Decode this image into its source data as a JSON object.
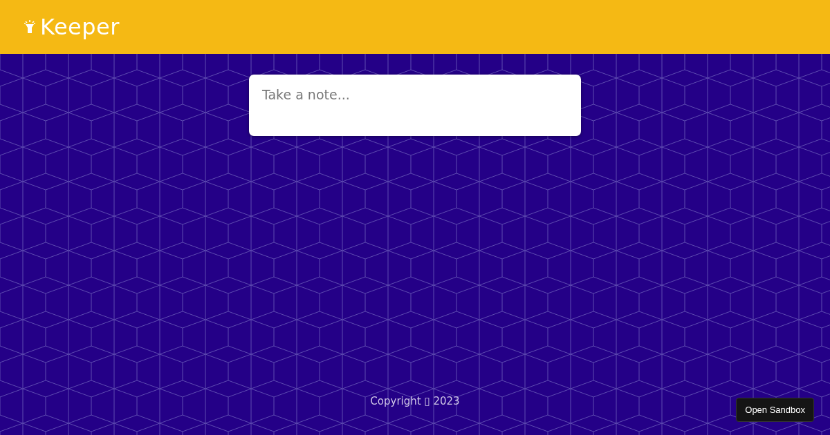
{
  "header": {
    "title": "Keeper"
  },
  "note_form": {
    "placeholder": "Take a note..."
  },
  "footer": {
    "text": "Copyright ▯ 2023"
  },
  "sandbox_button": {
    "label": "Open Sandbox"
  }
}
